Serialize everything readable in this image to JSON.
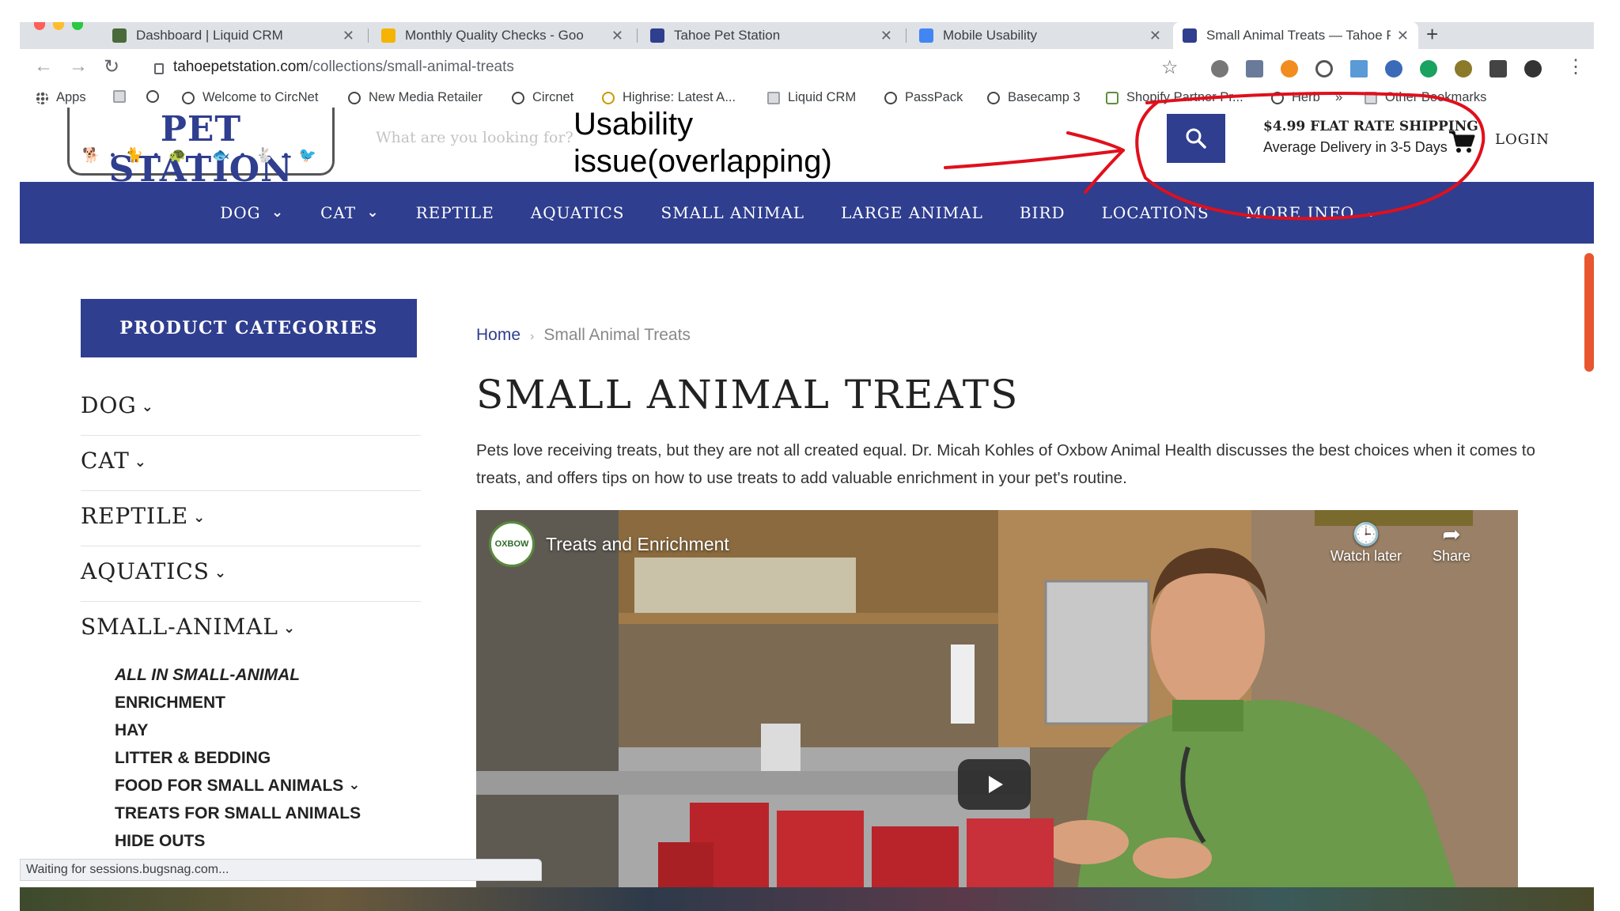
{
  "browser": {
    "tabs": [
      {
        "title": "Dashboard | Liquid CRM",
        "color": "#4a6a3a"
      },
      {
        "title": "Monthly Quality Checks - Goo",
        "color": "#f4b400"
      },
      {
        "title": "Tahoe Pet Station",
        "color": "#2f3e8f"
      },
      {
        "title": "Mobile Usability",
        "color": "#4285f4"
      },
      {
        "title": "Small Animal Treats — Tahoe P",
        "color": "#2f3e8f"
      }
    ],
    "url_host": "tahoepetstation.com",
    "url_path": "/collections/small-animal-treats",
    "bookmarks": {
      "apps": "Apps",
      "b1": "Welcome to CircNet",
      "b2": "New Media Retailer",
      "b3": "Circnet",
      "b4": "Highrise: Latest A...",
      "b5": "Liquid CRM",
      "b6": "PassPack",
      "b7": "Basecamp 3",
      "b8": "Shopify Partner Pr...",
      "b9": "Herb",
      "other": "Other Bookmarks"
    },
    "status": "Waiting for sessions.bugsnag.com..."
  },
  "site": {
    "logo_text": "PET STATION",
    "search_placeholder": "What are you looking for?",
    "shipping_line1": "$4.99 FLAT RATE SHIPPING",
    "shipping_line2": "Average Delivery in 3-5 Days",
    "login": "LOGIN",
    "nav": [
      "DOG",
      "CAT",
      "REPTILE",
      "AQUATICS",
      "SMALL ANIMAL",
      "LARGE ANIMAL",
      "BIRD",
      "LOCATIONS",
      "MORE INFO"
    ],
    "annotation": {
      "line1": "Usability",
      "line2": "issue(overlapping)",
      "color": "#e0101c"
    }
  },
  "sidebar": {
    "heading": "PRODUCT CATEGORIES",
    "categories": [
      "DOG",
      "CAT",
      "REPTILE",
      "AQUATICS",
      "SMALL-ANIMAL"
    ],
    "subitems": [
      "ALL IN SMALL-ANIMAL",
      "ENRICHMENT",
      "HAY",
      "LITTER & BEDDING",
      "FOOD FOR SMALL ANIMALS",
      "TREATS FOR SMALL ANIMALS",
      "HIDE OUTS"
    ]
  },
  "main": {
    "breadcrumb_home": "Home",
    "breadcrumb_current": "Small Animal Treats",
    "title": "SMALL ANIMAL TREATS",
    "description": "Pets love receiving treats, but they are not all created equal. Dr. Micah Kohles of Oxbow Animal Health discusses the best choices when it comes to treats, and offers tips on how to use treats to add valuable enrichment in your pet's routine.",
    "video": {
      "title": "Treats and Enrichment",
      "channel_logo": "OXBOW",
      "watch_later": "Watch later",
      "share": "Share"
    }
  },
  "colors": {
    "brand": "#2f3e8f",
    "annotation": "#e0101c"
  }
}
